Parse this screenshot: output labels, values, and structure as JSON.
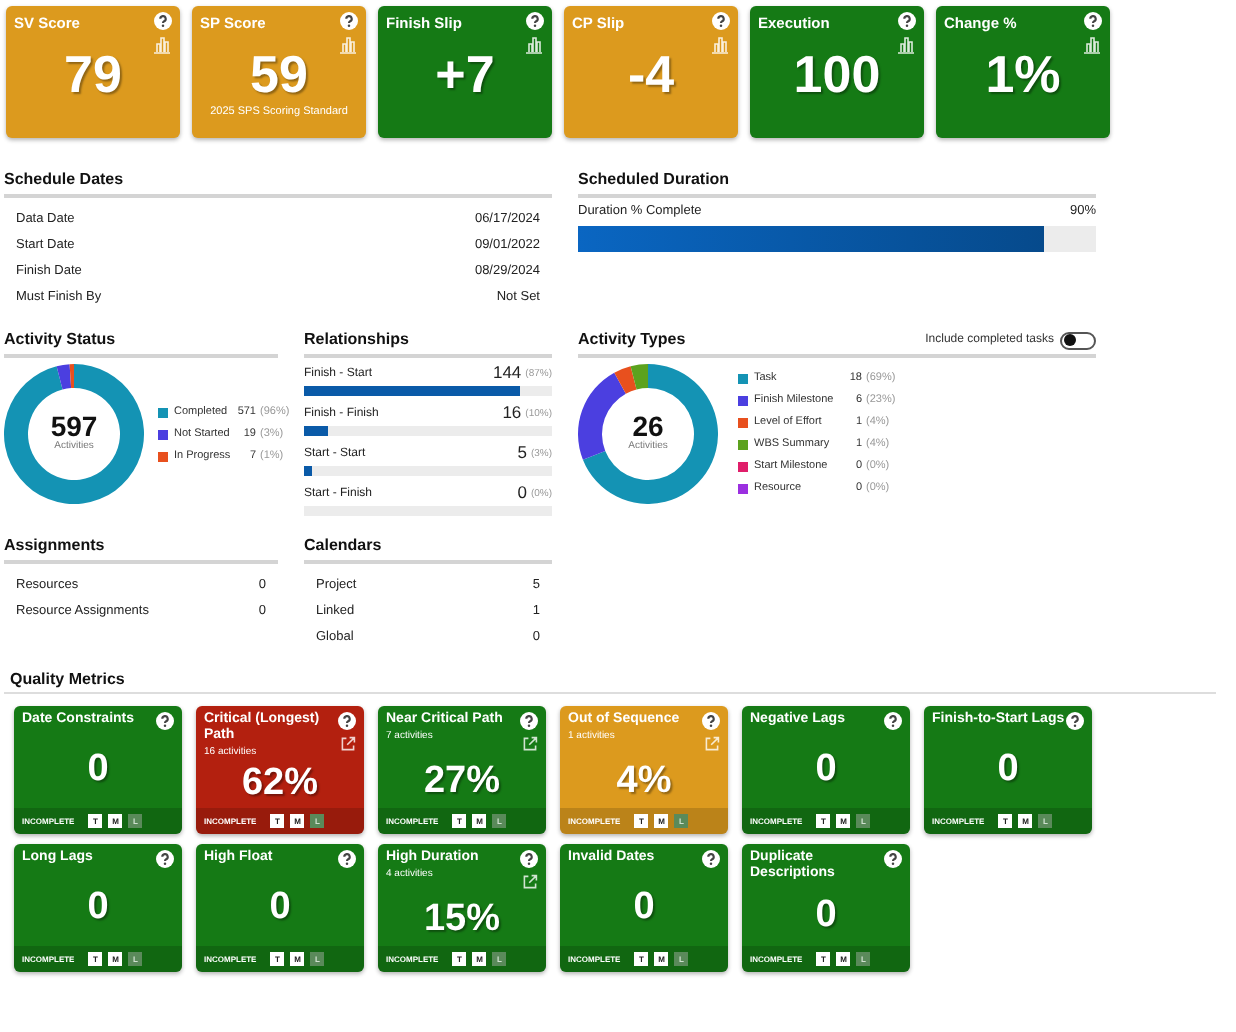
{
  "score_cards": [
    {
      "title": "SV Score",
      "value": "79",
      "color": "#dc9a1e"
    },
    {
      "title": "SP Score",
      "value": "59",
      "subtitle": "2025 SPS Scoring Standard",
      "color": "#dc9a1e"
    },
    {
      "title": "Finish Slip",
      "value": "+7",
      "color": "#157a15"
    },
    {
      "title": "CP Slip",
      "value": "-4",
      "color": "#dc9a1e"
    },
    {
      "title": "Execution",
      "value": "100",
      "color": "#157a15"
    },
    {
      "title": "Change %",
      "value": "1%",
      "color": "#157a15"
    }
  ],
  "schedule_dates": {
    "title": "Schedule Dates",
    "rows": [
      {
        "label": "Data Date",
        "value": "06/17/2024"
      },
      {
        "label": "Start Date",
        "value": "09/01/2022"
      },
      {
        "label": "Finish Date",
        "value": "08/29/2024"
      },
      {
        "label": "Must Finish By",
        "value": "Not Set"
      }
    ]
  },
  "scheduled_duration": {
    "title": "Scheduled Duration",
    "label": "Duration % Complete",
    "reading": "90%",
    "level": 0.9
  },
  "activity_status": {
    "title": "Activity Status",
    "total": "597",
    "total_label": "Activities",
    "chart_data": {
      "type": "donut",
      "categories": [
        "Completed",
        "Not Started",
        "In Progress"
      ],
      "values": [
        96,
        3,
        1
      ]
    },
    "legend": [
      {
        "count": "571",
        "pct": "(96%)",
        "color": "#1493b4"
      },
      {
        "count": "19",
        "pct": "(3%)",
        "color": "#4b3fe0"
      },
      {
        "count": "7",
        "pct": "(1%)",
        "color": "#e8501e"
      }
    ]
  },
  "relationships": {
    "title": "Relationships",
    "rows": [
      {
        "label": "Finish - Start",
        "count": "144",
        "pct": "(87%)",
        "level": 0.87
      },
      {
        "label": "Finish - Finish",
        "count": "16",
        "pct": "(10%)",
        "level": 0.1
      },
      {
        "label": "Start - Start",
        "count": "5",
        "pct": "(3%)",
        "level": 0.03
      },
      {
        "label": "Start - Finish",
        "count": "0",
        "pct": "(0%)"
      }
    ]
  },
  "activity_types": {
    "title": "Activity Types",
    "toggle": {
      "label": "Include completed tasks",
      "on": false
    },
    "total": "26",
    "total_label": "Activities",
    "chart_data": {
      "type": "donut",
      "categories": [
        "Task",
        "Finish Milestone",
        "Level of Effort",
        "WBS Summary",
        "Start Milestone",
        "Resource"
      ],
      "values": [
        69,
        23,
        4,
        4,
        0,
        0
      ]
    },
    "legend": [
      {
        "count": "18",
        "pct": "(69%)",
        "color": "#1493b4"
      },
      {
        "count": "6",
        "pct": "(23%)",
        "color": "#4b3fe0"
      },
      {
        "count": "1",
        "pct": "(4%)",
        "color": "#e8501e"
      },
      {
        "count": "1",
        "pct": "(4%)",
        "color": "#5ca21e"
      },
      {
        "count": "0",
        "pct": "(0%)",
        "color": "#e01e6a"
      },
      {
        "count": "0",
        "pct": "(0%)",
        "color": "#9b2fe0"
      }
    ]
  },
  "assignments": {
    "title": "Assignments",
    "rows": [
      {
        "label": "Resources",
        "value": "0"
      },
      {
        "label": "Resource Assignments",
        "value": "0"
      }
    ]
  },
  "calendars": {
    "title": "Calendars",
    "rows": [
      {
        "label": "Project",
        "value": "5"
      },
      {
        "label": "Linked",
        "value": "1"
      },
      {
        "label": "Global",
        "value": "0"
      }
    ]
  },
  "quality_metrics": {
    "title": "Quality Metrics",
    "cards": [
      {
        "title": "Date Constraints",
        "value": "0",
        "color": "#157a15",
        "link": false,
        "status": "INCOMPLETE",
        "flags": [
          {
            "label": "T",
            "on": true
          },
          {
            "label": "M",
            "on": true
          },
          {
            "label": "L",
            "on": false
          }
        ]
      },
      {
        "title": "Critical (Longest) Path",
        "subtitle": "16 activities",
        "value": "62%",
        "color": "#b3200f",
        "link": true,
        "status": "INCOMPLETE",
        "flags": [
          {
            "label": "T",
            "on": true
          },
          {
            "label": "M",
            "on": true
          },
          {
            "label": "L",
            "on": false
          }
        ]
      },
      {
        "title": "Near Critical Path",
        "subtitle": "7 activities",
        "value": "27%",
        "color": "#157a15",
        "link": true,
        "status": "INCOMPLETE",
        "flags": [
          {
            "label": "T",
            "on": true
          },
          {
            "label": "M",
            "on": true
          },
          {
            "label": "L",
            "on": false
          }
        ]
      },
      {
        "title": "Out of Sequence",
        "subtitle": "1 activities",
        "value": "4%",
        "color": "#dc9a1e",
        "link": true,
        "status": "INCOMPLETE",
        "flags": [
          {
            "label": "T",
            "on": true
          },
          {
            "label": "M",
            "on": true
          },
          {
            "label": "L",
            "on": false
          }
        ]
      },
      {
        "title": "Negative Lags",
        "value": "0",
        "color": "#157a15",
        "link": false,
        "status": "INCOMPLETE",
        "flags": [
          {
            "label": "T",
            "on": true
          },
          {
            "label": "M",
            "on": true
          },
          {
            "label": "L",
            "on": false
          }
        ]
      },
      {
        "title": "Finish-to-Start Lags",
        "value": "0",
        "color": "#157a15",
        "link": false,
        "status": "INCOMPLETE",
        "flags": [
          {
            "label": "T",
            "on": true
          },
          {
            "label": "M",
            "on": true
          },
          {
            "label": "L",
            "on": false
          }
        ]
      },
      {
        "title": "Long Lags",
        "value": "0",
        "color": "#157a15",
        "link": false,
        "status": "INCOMPLETE",
        "flags": [
          {
            "label": "T",
            "on": true
          },
          {
            "label": "M",
            "on": true
          },
          {
            "label": "L",
            "on": false
          }
        ]
      },
      {
        "title": "High Float",
        "value": "0",
        "color": "#157a15",
        "link": false,
        "status": "INCOMPLETE",
        "flags": [
          {
            "label": "T",
            "on": true
          },
          {
            "label": "M",
            "on": true
          },
          {
            "label": "L",
            "on": false
          }
        ]
      },
      {
        "title": "High Duration",
        "subtitle": "4 activities",
        "value": "15%",
        "color": "#157a15",
        "link": true,
        "status": "INCOMPLETE",
        "flags": [
          {
            "label": "T",
            "on": true
          },
          {
            "label": "M",
            "on": true
          },
          {
            "label": "L",
            "on": false
          }
        ]
      },
      {
        "title": "Invalid Dates",
        "value": "0",
        "color": "#157a15",
        "link": false,
        "status": "INCOMPLETE",
        "flags": [
          {
            "label": "T",
            "on": true
          },
          {
            "label": "M",
            "on": true
          },
          {
            "label": "L",
            "on": false
          }
        ]
      },
      {
        "title": "Duplicate Descriptions",
        "value": "0",
        "color": "#157a15",
        "link": false,
        "status": "INCOMPLETE",
        "flags": [
          {
            "label": "T",
            "on": true
          },
          {
            "label": "M",
            "on": true
          },
          {
            "label": "L",
            "on": false
          }
        ]
      }
    ]
  }
}
